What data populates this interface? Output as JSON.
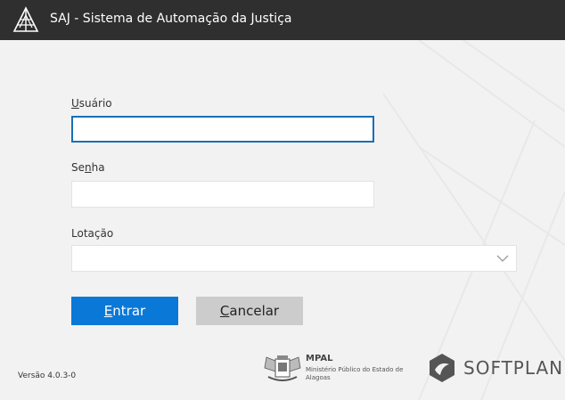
{
  "window": {
    "title": "SAJ - Sistema de Automação da Justiça"
  },
  "form": {
    "usuario": {
      "label_pre": "",
      "label_u": "U",
      "label_post": "suário",
      "value": ""
    },
    "senha": {
      "label_pre": "Se",
      "label_u": "n",
      "label_post": "ha",
      "value": ""
    },
    "lotacao": {
      "label": "Lotação",
      "value": ""
    }
  },
  "buttons": {
    "entrar": {
      "u": "E",
      "rest": "ntrar"
    },
    "cancelar": {
      "u": "C",
      "rest": "ancelar"
    }
  },
  "footer": {
    "version": "Versão 4.0.3-0",
    "mpal_name": "MPAL",
    "mpal_sub": "Ministério Público do Estado de Alagoas",
    "softplan": "SOFTPLAN"
  },
  "colors": {
    "titlebar": "#2f2f2f",
    "background": "#f2f2f2",
    "primary_button": "#0a78d7",
    "secondary_button": "#cccccc",
    "focus_border": "#1a6fb5"
  },
  "icons": {
    "app": "saj-logo-icon",
    "dropdown": "chevron-down-icon",
    "mpal": "mpal-seal-icon",
    "softplan": "softplan-logo-icon"
  }
}
